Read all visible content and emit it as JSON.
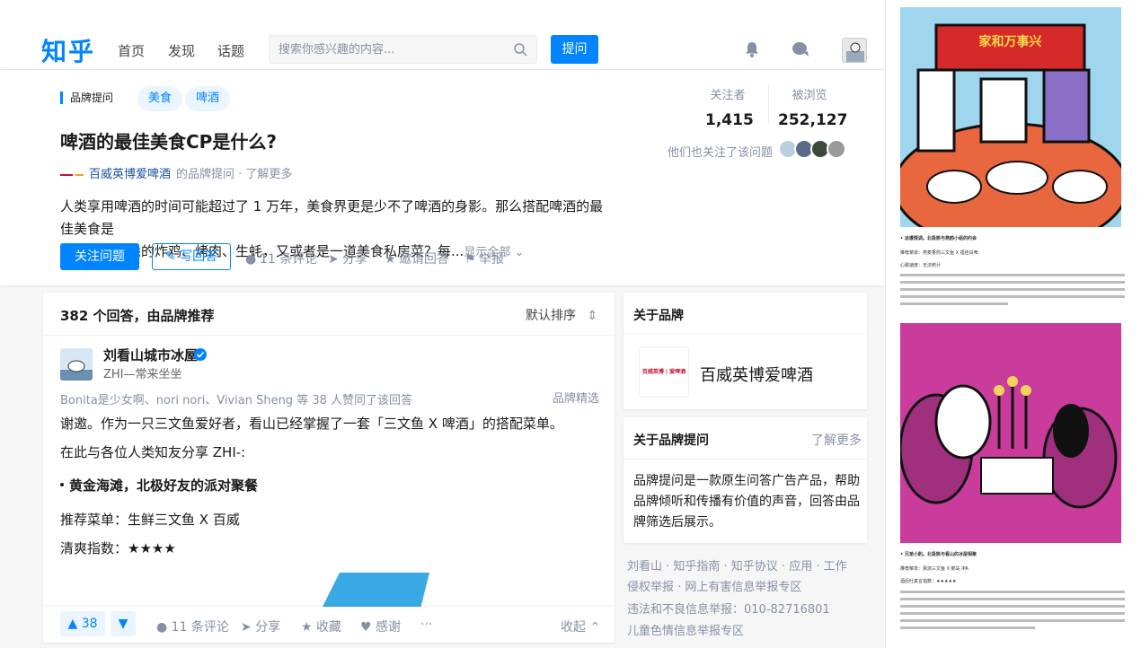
{
  "header": {
    "logo": "知乎",
    "nav": [
      "首页",
      "发现",
      "话题"
    ],
    "search_placeholder": "搜索你感兴趣的内容...",
    "ask_label": "提问"
  },
  "question": {
    "brand_tag": "品牌提问",
    "topics": [
      "美食",
      "啤酒"
    ],
    "title": "啤酒的最佳美食CP是什么?",
    "brand_name": "百威英博爱啤酒",
    "brand_suffix": "的品牌提问 · 了解更多",
    "desc_line1": "人类享用啤酒的时间可能超过了 1 万年，美食界更是少不了啤酒的身影。那么搭配啤酒的最佳美食是",
    "desc_line2": "什么？是熟悉的炸鸡、烤肉、生蚝，又或者是一道美食私房菜？每...",
    "show_all": "显示全部",
    "follow_label": "关注问题",
    "write_label": "写回答",
    "comments": "11 条评论",
    "share": "分享",
    "invite": "邀请回答",
    "report": "举报",
    "followers_label": "关注者",
    "followers": "1,415",
    "views_label": "被浏览",
    "views": "252,127",
    "also_follow": "他们也关注了该问题"
  },
  "answers": {
    "count_label": "382 个回答，由品牌推荐",
    "sort_label": "默认排序",
    "author_name": "刘看山城市冰屋",
    "author_bio": "ZHI—常来坐坐",
    "voters": "Bonita是少女啊、nori nori、Vivian Sheng 等 38 人赞同了该回答",
    "picked": "品牌精选",
    "p1": "谢邀。作为一只三文鱼爱好者，看山已经掌握了一套「三文鱼 X 啤酒」的搭配菜单。",
    "p2": "在此与各位人类知友分享 ZHI-:",
    "bullet1": "黄金海滩，北极好友的派对聚餐",
    "p3": "推荐菜单：生鲜三文鱼 X 百威",
    "p4": "清爽指数：★★★★",
    "votes": "38",
    "comments": "11 条评论",
    "share": "分享",
    "collect": "收藏",
    "thanks": "感谢",
    "more": "···",
    "collapse": "收起"
  },
  "sidebar": {
    "about_brand_title": "关于品牌",
    "brand_logo_text": "百威英博 | 爱啤酒",
    "brand_name": "百威英博爱啤酒",
    "about_ask_title": "关于品牌提问",
    "learn_more": "了解更多",
    "about_ask_text": "品牌提问是一款原生问答广告产品，帮助品牌倾听和传播有价值的声音，回答由品牌筛选后展示。",
    "footer": [
      "刘看山 · 知乎指南 · 知乎协议 · 应用 · 工作",
      "侵权举报 · 网上有害信息举报专区",
      "违法和不良信息举报：010-82716801",
      "儿童色情信息举报专区"
    ]
  },
  "strip": {
    "banner": "家和万事兴",
    "t1": "•  派遣情调。北极熊与燕鸥小组的约会",
    "t2": "推荐菜单：燕麦香煎三文鱼 X 福佳白啤",
    "t3": "心跳速度：无法统计",
    "t5": "•  兄弟小酌。北极熊与看山的冰屋相聚",
    "t6": "推荐菜单：熏烧三文鱼 X 鹅岛 IPA",
    "t7": "酒后吐真言指数：★★★★★"
  },
  "colors": {
    "accent": "#0084ff",
    "muted": "#8590a6",
    "link": "#175199"
  }
}
